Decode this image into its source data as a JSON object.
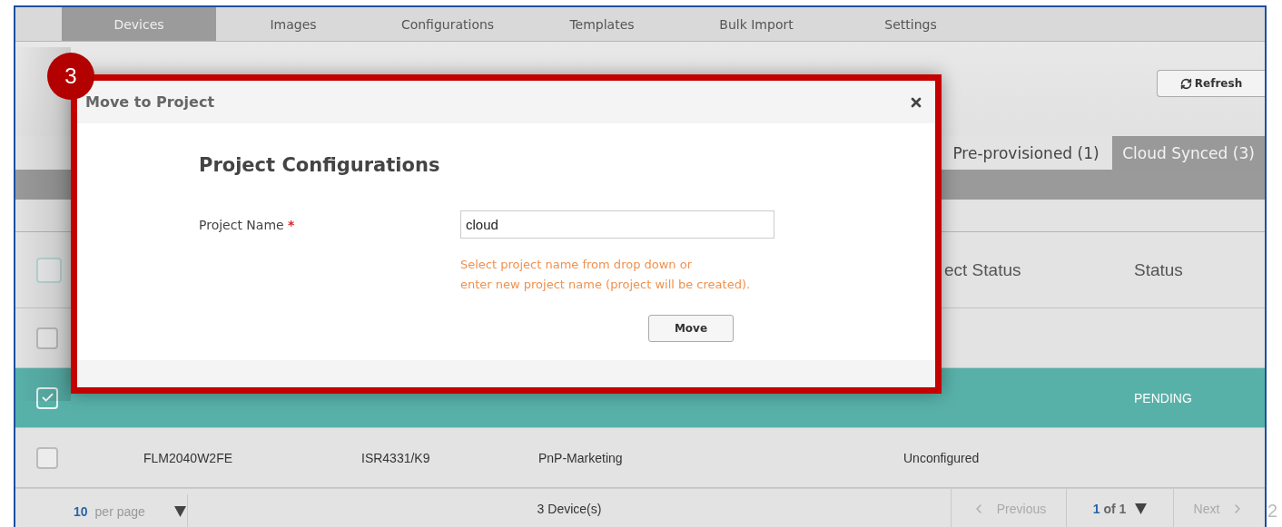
{
  "nav_tabs": [
    {
      "label": "Devices",
      "selected": true
    },
    {
      "label": "Images",
      "selected": false
    },
    {
      "label": "Configurations",
      "selected": false
    },
    {
      "label": "Templates",
      "selected": false
    },
    {
      "label": "Bulk Import",
      "selected": false
    },
    {
      "label": "Settings",
      "selected": false
    }
  ],
  "refresh_button": {
    "label": "Refresh"
  },
  "view_tabs": [
    {
      "label": "Pre-provisioned (1)",
      "selected": false
    },
    {
      "label": "Cloud Synced (3)",
      "selected": true
    }
  ],
  "table": {
    "select_all_checked": false,
    "column_5": "ect Status",
    "column_6": "Status",
    "rows": [
      {
        "checked": false,
        "selected": false,
        "cells": {}
      },
      {
        "checked": true,
        "selected": true,
        "cells": {
          "status": "PENDING"
        }
      },
      {
        "checked": false,
        "selected": false,
        "cells": {
          "serial": "FLM2040W2FE",
          "pid": "ISR4331/K9",
          "project": "PnP-Marketing",
          "project_status": "Unconfigured"
        }
      }
    ]
  },
  "footer": {
    "per_page_value": "10",
    "per_page_label": "per page",
    "count": "3 Device(s)",
    "previous": "Previous",
    "page_current": "1",
    "page_total": "of 1",
    "next": "Next"
  },
  "dialog": {
    "title": "Move to Project",
    "heading": "Project Configurations",
    "field_label": "Project Name",
    "required_mark": "*",
    "field_value": "cloud",
    "help_lines": [
      "Select project name from drop down or",
      "enter new project name (project will be created)."
    ],
    "move_button": "Move"
  },
  "step_badge": "3",
  "page_number": "2"
}
